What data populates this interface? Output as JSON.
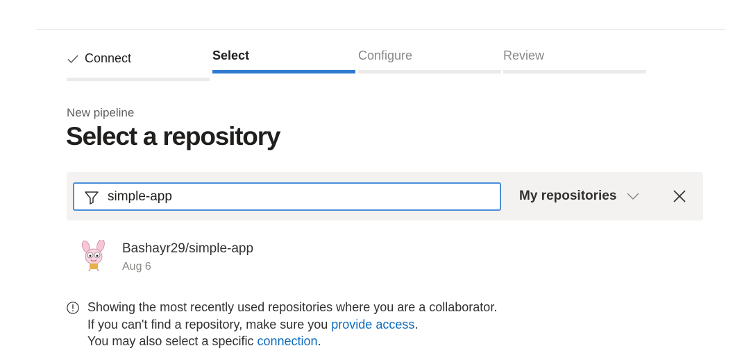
{
  "stepper": {
    "steps": [
      {
        "label": "Connect",
        "state": "done"
      },
      {
        "label": "Select",
        "state": "active"
      },
      {
        "label": "Configure",
        "state": "todo"
      },
      {
        "label": "Review",
        "state": "todo"
      }
    ],
    "active_color": "#2f7bd0"
  },
  "header": {
    "subtitle": "New pipeline",
    "title": "Select a repository"
  },
  "filter": {
    "search_value": "simple-app",
    "filter_icon": "filter-icon",
    "scope_label": "My repositories",
    "scope_icon": "chevron-down-icon",
    "clear_icon": "close-icon"
  },
  "repos": [
    {
      "name": "Bashayr29/simple-app",
      "date": "Aug 6",
      "avatar_icon": "avatar"
    }
  ],
  "info": {
    "icon": "info-icon",
    "line1": "Showing the most recently used repositories where you are a collaborator.",
    "line2_prefix": "If you can't find a repository, make sure you ",
    "line2_link": "provide access",
    "line2_suffix": ".",
    "line3_prefix": "You may also select a specific ",
    "line3_link": "connection",
    "line3_suffix": ".",
    "link_color": "#0f6cbd"
  }
}
